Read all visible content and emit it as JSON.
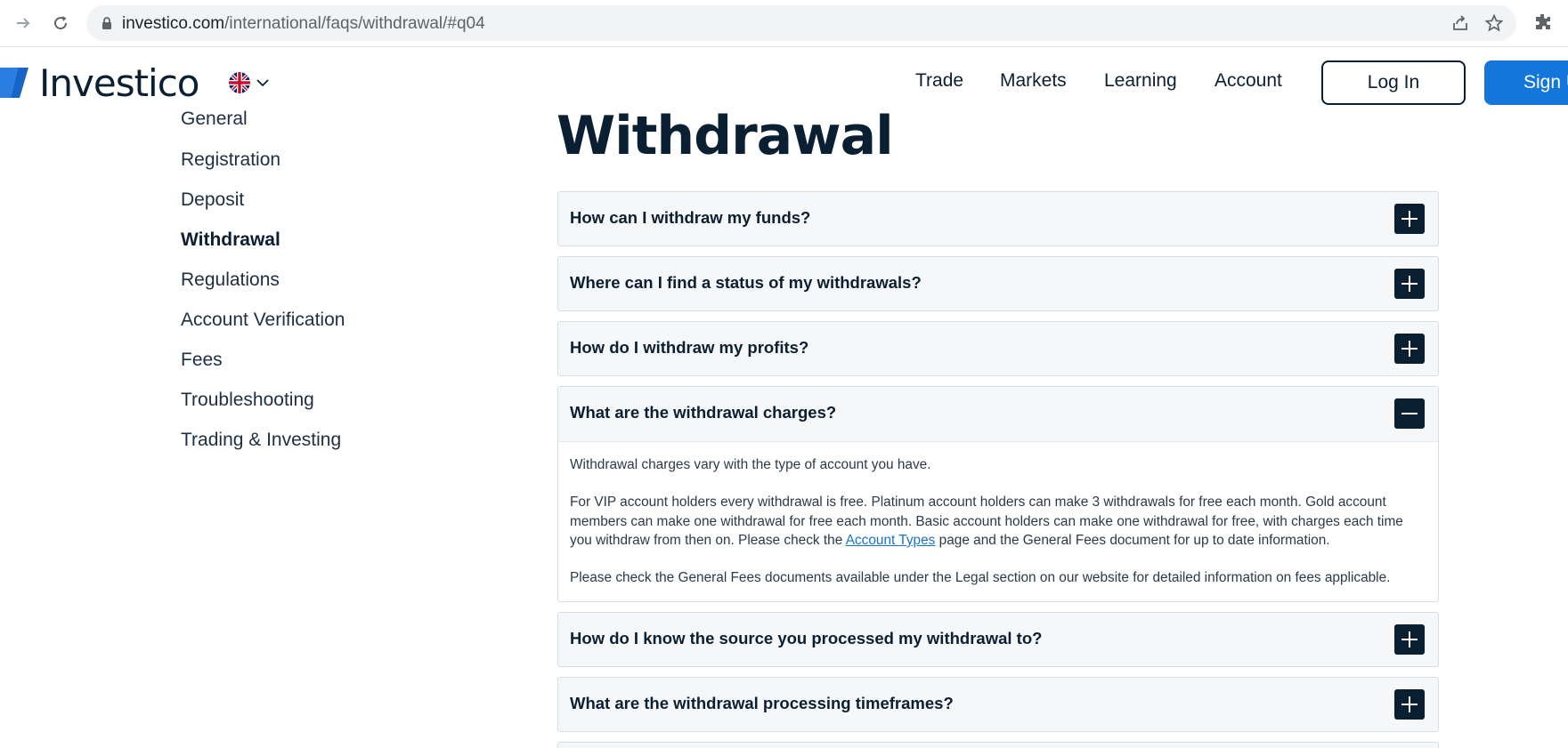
{
  "browser": {
    "url_host": "investico.com",
    "url_path": "/international/faqs/withdrawal/#q04"
  },
  "header": {
    "logo_text": "Investico",
    "menu": [
      "Trade",
      "Markets",
      "Learning",
      "Account"
    ],
    "login_label": "Log In",
    "signup_label": "Sign Up"
  },
  "sidebar": {
    "items": [
      "General",
      "Registration",
      "Deposit",
      "Withdrawal",
      "Regulations",
      "Account Verification",
      "Fees",
      "Troubleshooting",
      "Trading & Investing"
    ],
    "active": "Withdrawal"
  },
  "main": {
    "title": "Withdrawal",
    "faqs": [
      {
        "question": "How can I withdraw my funds?",
        "state": "collapsed"
      },
      {
        "question": "Where can I find a status of my withdrawals?",
        "state": "collapsed"
      },
      {
        "question": "How do I withdraw my profits?",
        "state": "collapsed"
      },
      {
        "question": "What are the withdrawal charges?",
        "state": "expanded",
        "answer_p1": "Withdrawal charges vary with the type of account you have.",
        "answer_p2_before": "For VIP account holders every withdrawal is free. Platinum account holders can make 3 withdrawals for free each month. Gold account members can make one withdrawal for free each month. Basic account holders can make one withdrawal for free, with charges each time you withdraw from then on. Please check the ",
        "answer_p2_link": "Account Types",
        "answer_p2_after": " page and the General Fees document for up to date information.",
        "answer_p3": "Please check the General Fees documents available under the Legal section on our website for detailed information on fees applicable."
      },
      {
        "question": "How do I know the source you processed my withdrawal to?",
        "state": "collapsed"
      },
      {
        "question": "What are the withdrawal processing timeframes?",
        "state": "collapsed"
      }
    ]
  },
  "colors": {
    "navy": "#0b1f33",
    "brand_blue": "#1476db",
    "accordion_bg": "#f5f7f8",
    "link": "#1a73c7"
  }
}
